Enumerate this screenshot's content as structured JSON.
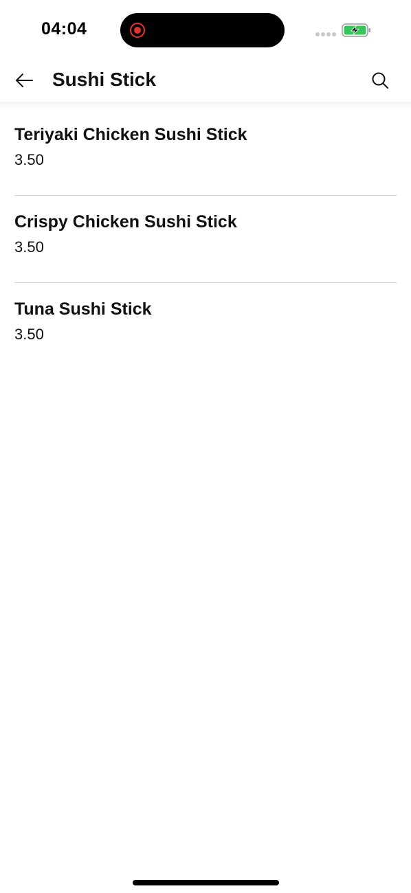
{
  "status_bar": {
    "time": "04:04",
    "record_indicator_color": "#e5322d",
    "battery_color": "#34c759"
  },
  "header": {
    "title": "Sushi Stick",
    "back_icon": "arrow-left-icon",
    "search_icon": "search-icon"
  },
  "items": [
    {
      "name": "Teriyaki Chicken Sushi Stick",
      "price": "3.50"
    },
    {
      "name": "Crispy Chicken Sushi Stick",
      "price": "3.50"
    },
    {
      "name": "Tuna Sushi Stick",
      "price": "3.50"
    }
  ]
}
